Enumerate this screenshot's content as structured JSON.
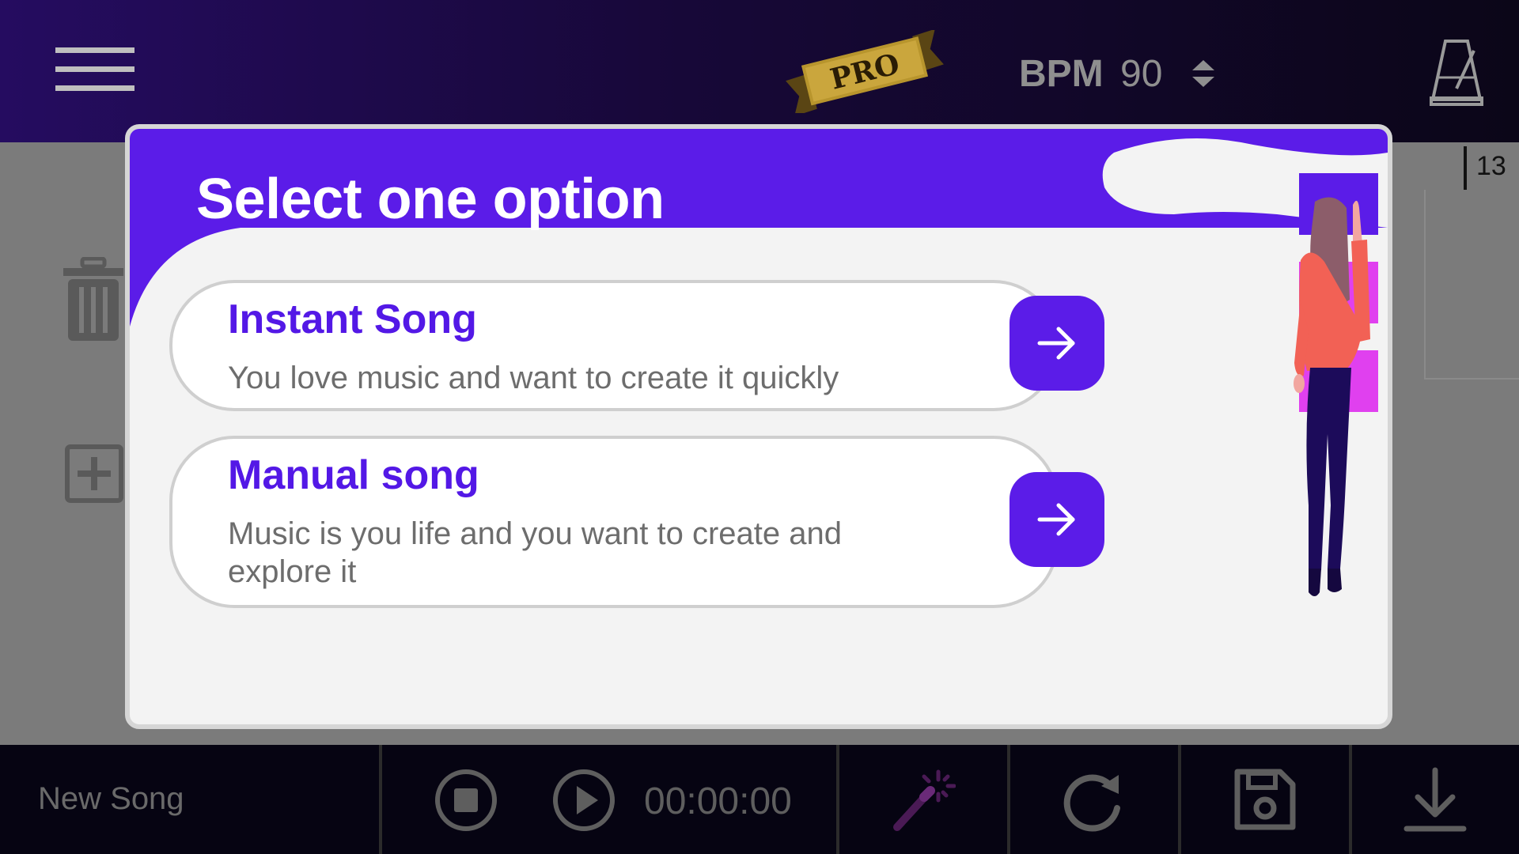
{
  "header": {
    "pro_badge": "PRO",
    "bpm_label": "BPM",
    "bpm_value": "90"
  },
  "workspace": {
    "bar_number": "13"
  },
  "dialog": {
    "title": "Select one option",
    "options": [
      {
        "title": "Instant Song",
        "description": "You love music and want to create it quickly"
      },
      {
        "title": "Manual song",
        "description": "Music is you life and you want to create and explore it"
      }
    ]
  },
  "footer": {
    "song_name": "New Song",
    "time": "00:00:00"
  },
  "colors": {
    "accent": "#5b1ce8",
    "header_gradient_start": "#250c60",
    "header_gradient_end": "#0b0618",
    "overlay_gray": "#7b7b7b",
    "pink_accent": "#e040ef"
  },
  "icons": {
    "menu": "hamburger-menu-icon",
    "metronome": "metronome-icon",
    "bpm_stepper": "up-down-stepper-icon",
    "trash": "trash-icon",
    "add_track": "plus-box-icon",
    "stop": "stop-circle-icon",
    "play": "play-circle-icon",
    "wand": "magic-wand-icon",
    "redo": "redo-icon",
    "save": "floppy-save-icon",
    "download": "download-icon",
    "arrow": "arrow-right-icon"
  }
}
